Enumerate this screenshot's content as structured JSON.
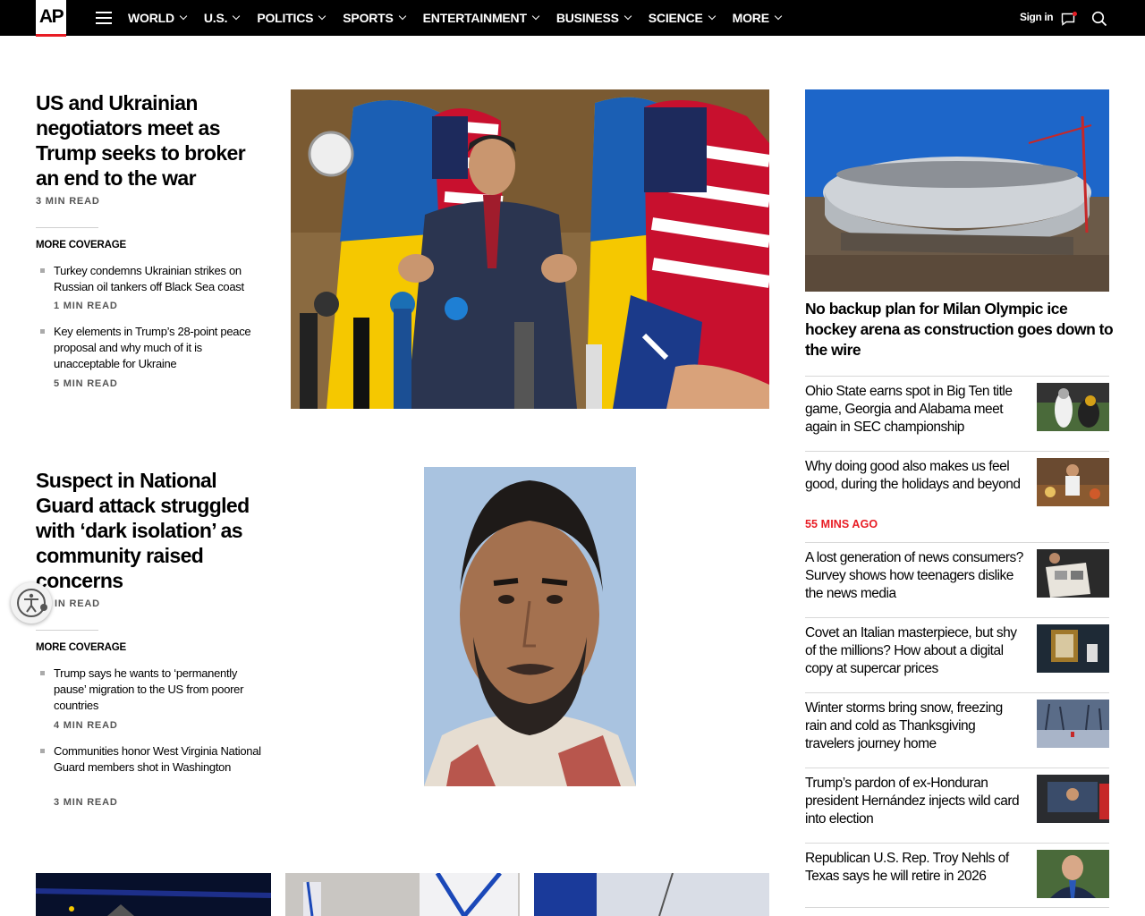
{
  "nav": {
    "logo": "AP",
    "items": [
      "WORLD",
      "U.S.",
      "POLITICS",
      "SPORTS",
      "ENTERTAINMENT",
      "BUSINESS",
      "SCIENCE",
      "MORE"
    ],
    "signin": "Sign in"
  },
  "story1": {
    "headline": "US and Ukrainian negotiators meet as Trump seeks to broker an end to the war",
    "readtime": "3 MIN READ",
    "more_coverage": "MORE COVERAGE",
    "items": [
      {
        "text": "Turkey condemns Ukrainian strikes on Russian oil tankers off Black Sea coast",
        "readtime": "1 MIN READ"
      },
      {
        "text": "Key elements in Trump’s 28-point peace proposal and why much of it is unacceptable for Ukraine",
        "readtime": "5 MIN READ"
      }
    ]
  },
  "story2": {
    "headline": "Suspect in National Guard attack struggled with ‘dark isolation’ as community raised concerns",
    "readtime": "IN READ",
    "more_coverage": "MORE COVERAGE",
    "items": [
      {
        "text": "Trump says he wants to ‘permanently pause’ migration to the US from poorer countries",
        "readtime": "4 MIN READ"
      },
      {
        "text": "Communities honor West Virginia National Guard members shot in Washington",
        "readtime": "3 MIN READ"
      }
    ]
  },
  "sidebar": {
    "feature_title": "No backup plan for Milan Olympic ice hockey arena as construction goes down to the wire",
    "items": [
      {
        "text": "Ohio State earns spot in Big Ten title game, Georgia and Alabama meet again in SEC championship"
      },
      {
        "text": "Why doing good also makes us feel good, during the holidays and beyond",
        "ago": "55 MINS AGO"
      },
      {
        "text": "A lost generation of news consumers? Survey shows how teenagers dislike the news media"
      },
      {
        "text": "Covet an Italian masterpiece, but shy of the millions? How about a digital copy at supercar prices"
      },
      {
        "text": "Winter storms bring snow, freezing rain and cold as Thanksgiving travelers journey home"
      },
      {
        "text": "Trump’s pardon of ex-Honduran president Hernández injects wild card into election"
      },
      {
        "text": "Republican U.S. Rep. Troy Nehls of Texas says he will retire in 2026"
      }
    ]
  },
  "colors": {
    "accent": "#e81c24",
    "nav_bg": "#000000"
  }
}
